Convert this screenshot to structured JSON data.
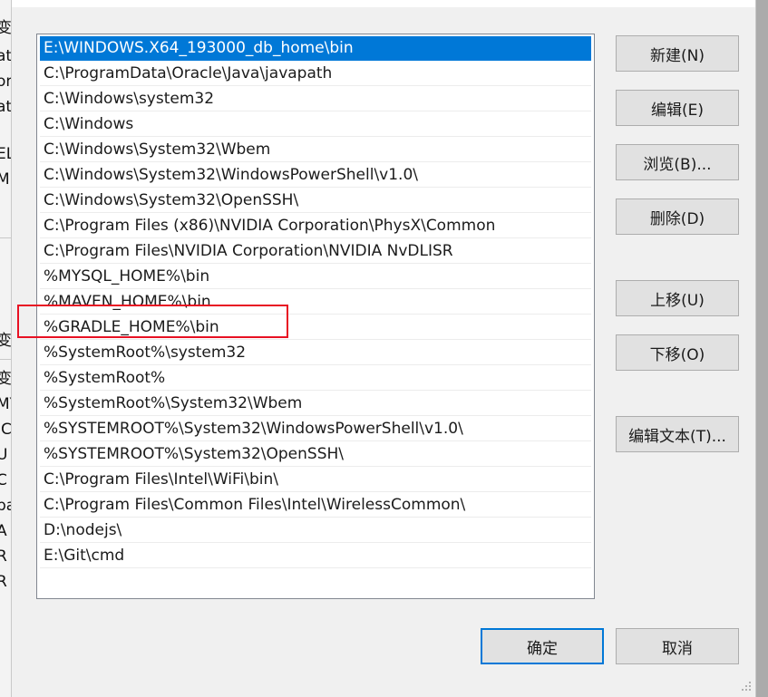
{
  "background_window": {
    "fragments": [
      "变",
      "at",
      "on",
      "at",
      "EL",
      "M",
      "变",
      "变",
      "MY",
      "IC",
      "U",
      "C",
      "ba",
      "A",
      "R",
      "R"
    ]
  },
  "dialog": {
    "path_entries": [
      "E:\\WINDOWS.X64_193000_db_home\\bin",
      "C:\\ProgramData\\Oracle\\Java\\javapath",
      "C:\\Windows\\system32",
      "C:\\Windows",
      "C:\\Windows\\System32\\Wbem",
      "C:\\Windows\\System32\\WindowsPowerShell\\v1.0\\",
      "C:\\Windows\\System32\\OpenSSH\\",
      "C:\\Program Files (x86)\\NVIDIA Corporation\\PhysX\\Common",
      "C:\\Program Files\\NVIDIA Corporation\\NVIDIA NvDLISR",
      "%MYSQL_HOME%\\bin",
      "%MAVEN_HOME%\\bin",
      "%GRADLE_HOME%\\bin",
      "%SystemRoot%\\system32",
      "%SystemRoot%",
      "%SystemRoot%\\System32\\Wbem",
      "%SYSTEMROOT%\\System32\\WindowsPowerShell\\v1.0\\",
      "%SYSTEMROOT%\\System32\\OpenSSH\\",
      "C:\\Program Files\\Intel\\WiFi\\bin\\",
      "C:\\Program Files\\Common Files\\Intel\\WirelessCommon\\",
      "D:\\nodejs\\",
      "E:\\Git\\cmd"
    ],
    "selected_index": 0,
    "highlighted_entry": "%GRADLE_HOME%\\bin",
    "buttons": {
      "new": "新建(N)",
      "edit": "编辑(E)",
      "browse": "浏览(B)...",
      "delete": "删除(D)",
      "move_up": "上移(U)",
      "move_down": "下移(O)",
      "edit_text": "编辑文本(T)...",
      "ok": "确定",
      "cancel": "取消"
    },
    "colors": {
      "selection": "#0078d7",
      "highlight_box": "#e81123"
    }
  }
}
